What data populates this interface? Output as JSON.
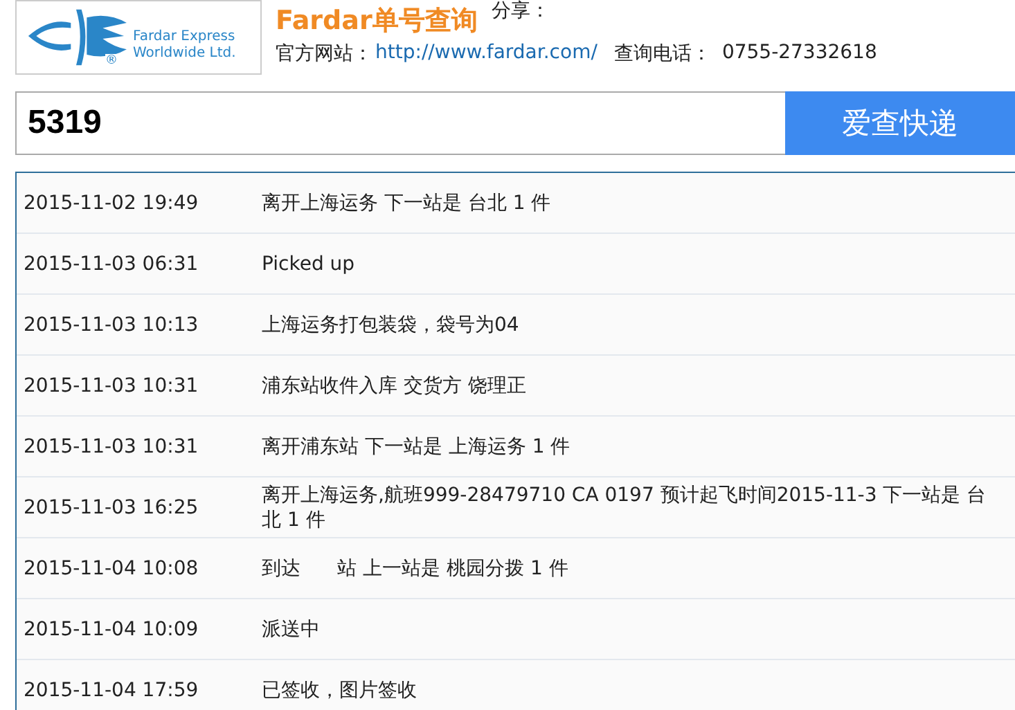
{
  "logo": {
    "line_1": "Fardar Express",
    "line_2": "Worldwide Ltd.",
    "mark": "®"
  },
  "header": {
    "title": "Fardar单号查询",
    "share_label": "分享：",
    "site_label": "官方网站：",
    "site_link": "http://www.fardar.com/",
    "phone_label": "查询电话：",
    "phone": "0755-27332618"
  },
  "search": {
    "value": "5319",
    "button": "爱查快递"
  },
  "events": [
    {
      "time": "2015-11-02 19:49",
      "text": "离开上海运务 下一站是 台北 1 件"
    },
    {
      "time": "2015-11-03 06:31",
      "text": "Picked up"
    },
    {
      "time": "2015-11-03 10:13",
      "text": "上海运务打包装袋，袋号为04"
    },
    {
      "time": "2015-11-03 10:31",
      "text": "浦东站收件入库 交货方 饶理正"
    },
    {
      "time": "2015-11-03 10:31",
      "text": "离开浦东站 下一站是 上海运务 1 件"
    },
    {
      "time": "2015-11-03 16:25",
      "text": "离开上海运务,航班999-28479710 CA 0197 预计起飞时间2015-11-3 下一站是 台北 1 件"
    },
    {
      "time": "2015-11-04 10:08",
      "text": "到达      站 上一站是 桃园分拨 1 件"
    },
    {
      "time": "2015-11-04 10:09",
      "text": "派送中"
    },
    {
      "time": "2015-11-04 17:59",
      "text": "已签收，图片签收"
    }
  ]
}
